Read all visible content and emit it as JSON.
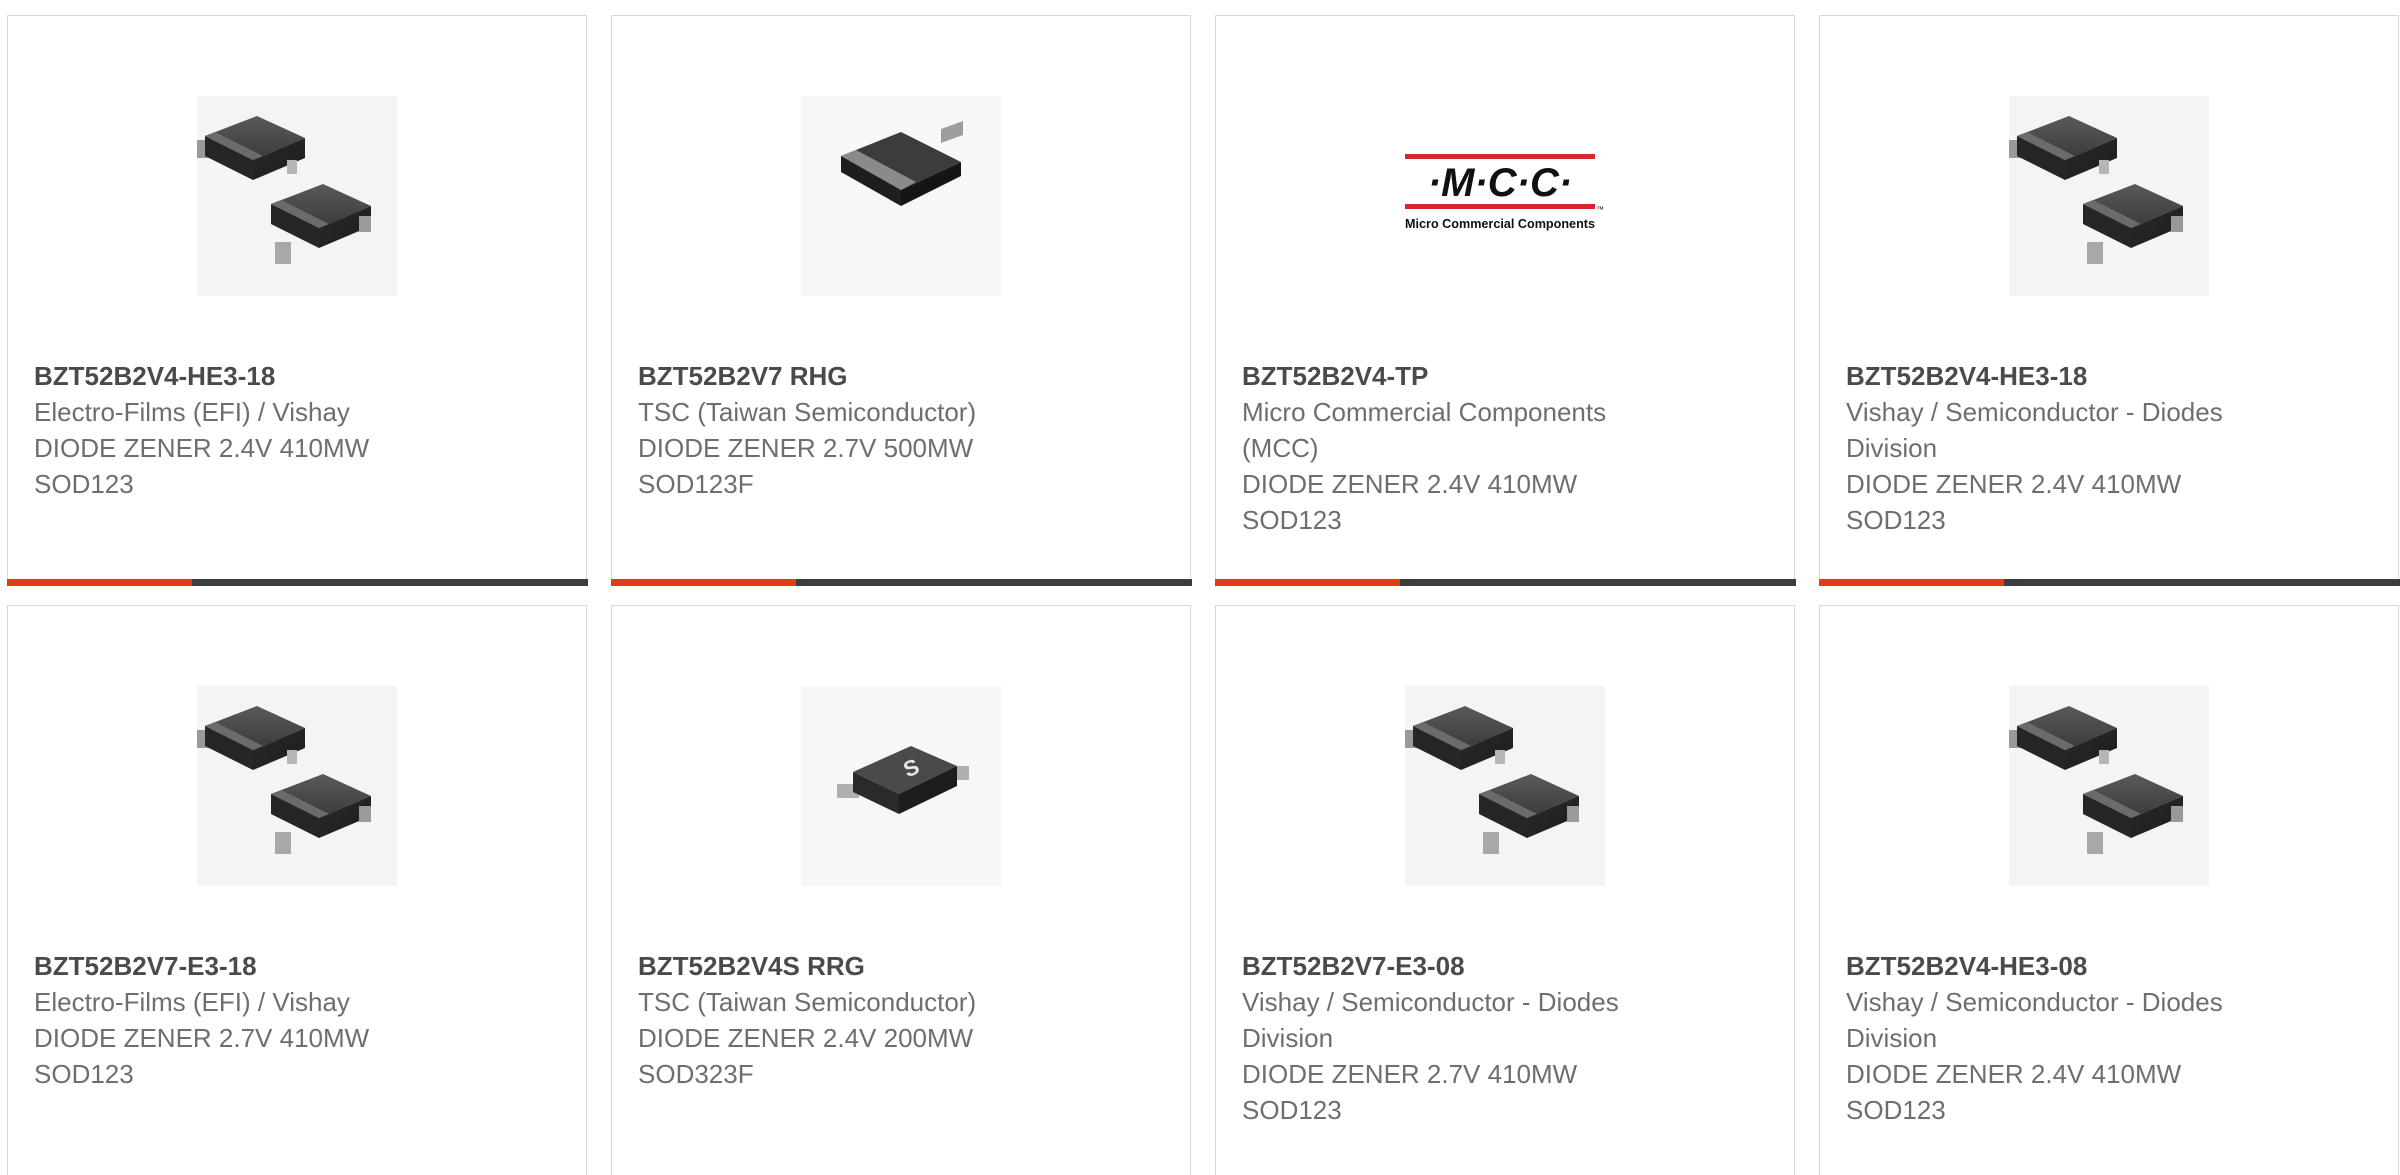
{
  "colors": {
    "accent": "#e03d16",
    "bar": "#3d3d3d",
    "border": "#d9d9d9",
    "text": "#6e6e6e",
    "title": "#4a4a4a"
  },
  "products": [
    {
      "part": "BZT52B2V4-HE3-18",
      "mfr": "Electro-Films (EFI) / Vishay",
      "desc": "DIODE ZENER 2.4V 410MW",
      "pkg": "SOD123",
      "image": "twin-sod123-diode-image"
    },
    {
      "part": "BZT52B2V7 RHG",
      "mfr": "TSC (Taiwan Semiconductor)",
      "desc": "DIODE ZENER 2.7V 500MW",
      "pkg": "SOD123F",
      "image": "sod123f-diode-image"
    },
    {
      "part": "BZT52B2V4-TP",
      "mfr": "Micro Commercial Components (MCC)",
      "desc": "DIODE ZENER 2.4V 410MW",
      "pkg": "SOD123",
      "image": "mcc-logo",
      "logo_text": "·M·C·C·",
      "logo_sub": "Micro Commercial Components",
      "logo_tm": "™"
    },
    {
      "part": "BZT52B2V4-HE3-18",
      "mfr": "Vishay / Semiconductor - Diodes Division",
      "desc": "DIODE ZENER 2.4V 410MW",
      "pkg": "SOD123",
      "image": "twin-sod123-diode-image"
    },
    {
      "part": "BZT52B2V7-E3-18",
      "mfr": "Electro-Films (EFI) / Vishay",
      "desc": "DIODE ZENER 2.7V 410MW",
      "pkg": "SOD123",
      "image": "twin-sod123-diode-image"
    },
    {
      "part": "BZT52B2V4S RRG",
      "mfr": "TSC (Taiwan Semiconductor)",
      "desc": "DIODE ZENER 2.4V 200MW",
      "pkg": "SOD323F",
      "image": "sod323f-diode-image"
    },
    {
      "part": "BZT52B2V7-E3-08",
      "mfr": "Vishay / Semiconductor - Diodes Division",
      "desc": "DIODE ZENER 2.7V 410MW",
      "pkg": "SOD123",
      "image": "twin-sod123-diode-image"
    },
    {
      "part": "BZT52B2V4-HE3-08",
      "mfr": "Vishay / Semiconductor - Diodes Division",
      "desc": "DIODE ZENER 2.4V 410MW",
      "pkg": "SOD123",
      "image": "twin-sod123-diode-image"
    }
  ]
}
